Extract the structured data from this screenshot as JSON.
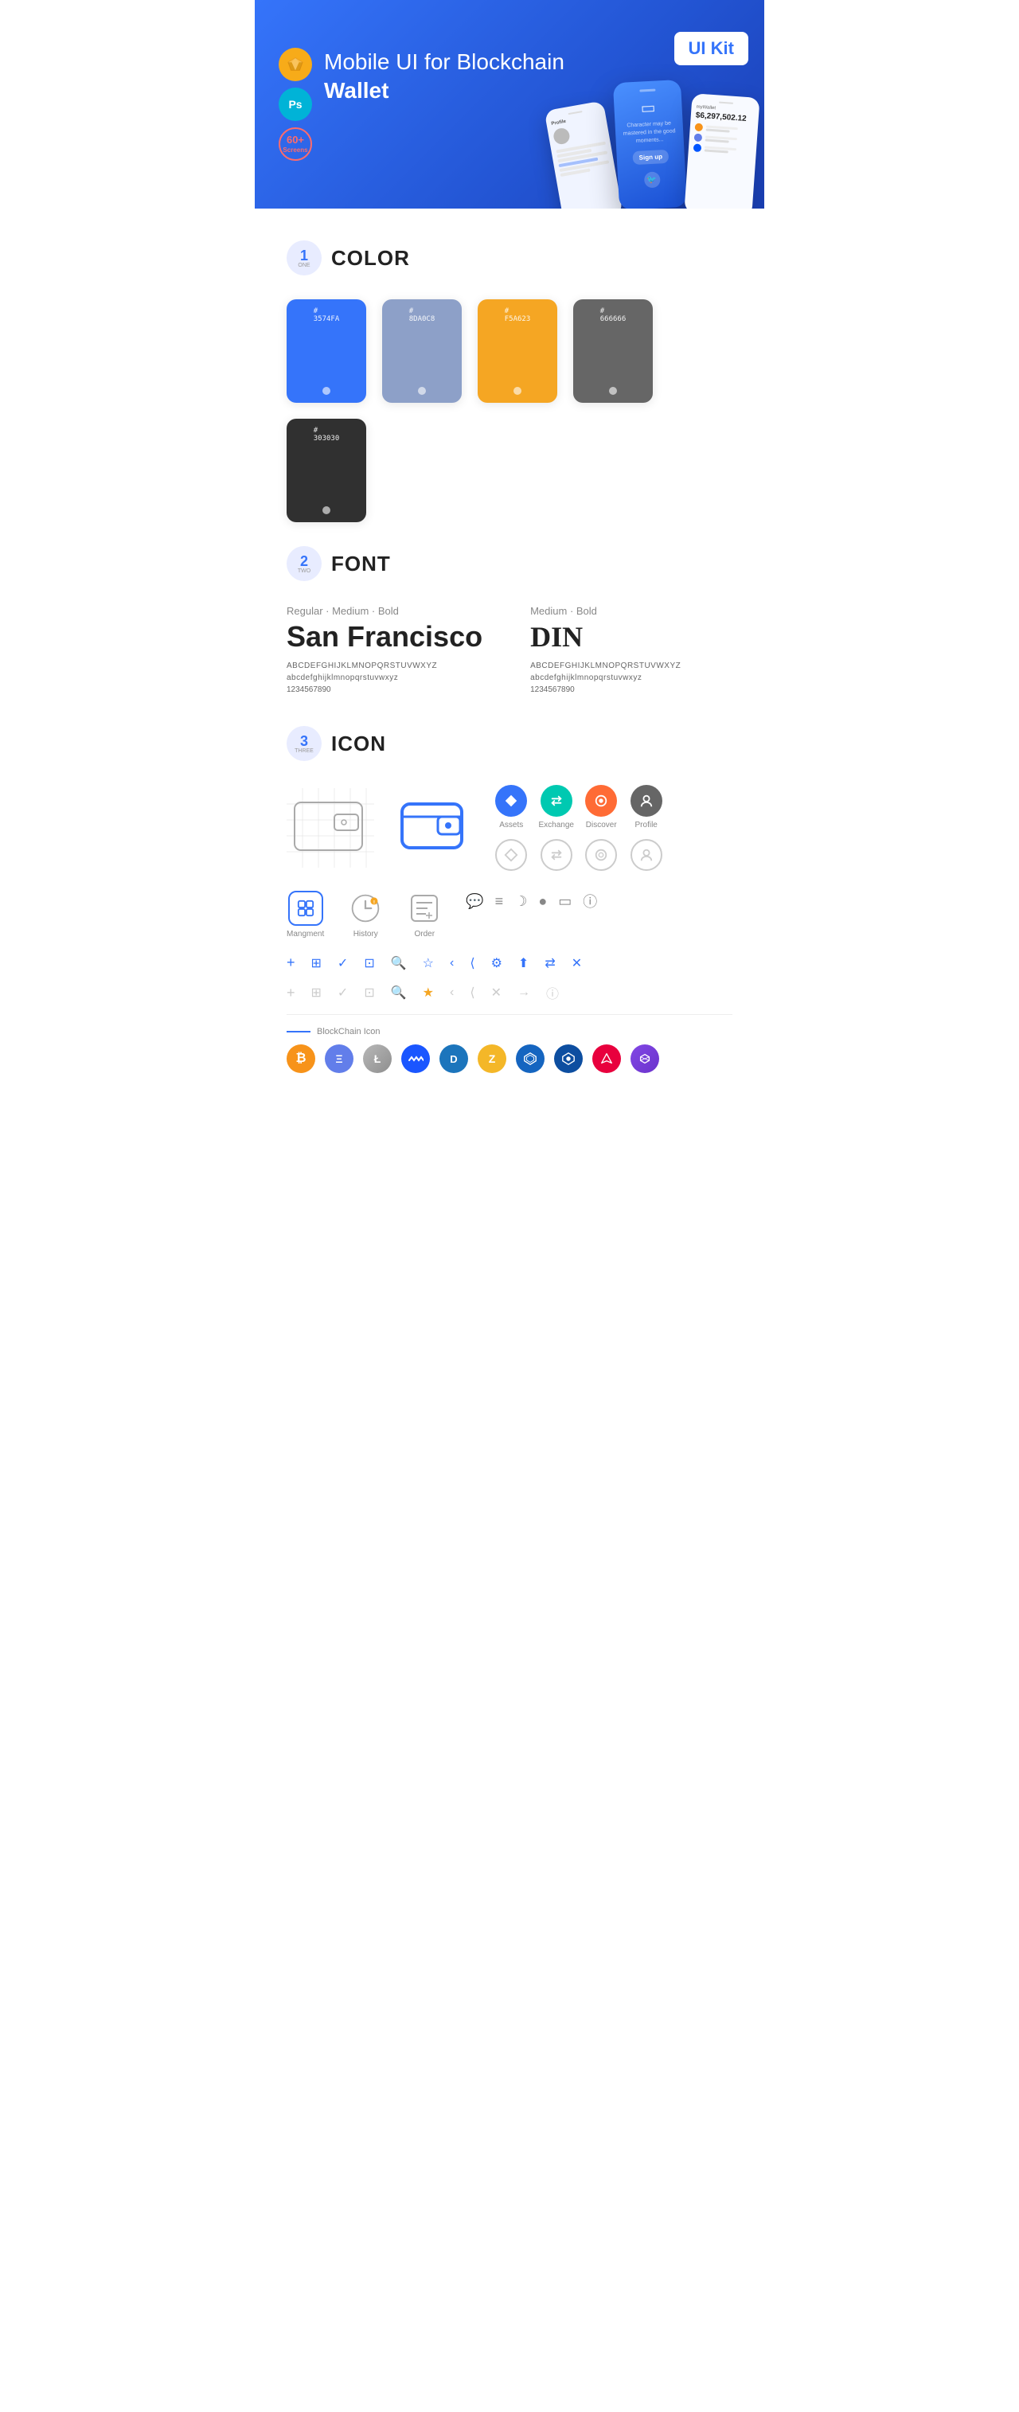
{
  "hero": {
    "title_regular": "Mobile UI for Blockchain ",
    "title_bold": "Wallet",
    "badge": "UI Kit",
    "sketch_label": "Sk",
    "ps_label": "Ps",
    "screens_label": "60+\nScreens"
  },
  "sections": {
    "color": {
      "number": "1",
      "number_sub": "ONE",
      "title": "COLOR",
      "swatches": [
        {
          "hex": "#3574FA",
          "label": "#\n3574FA",
          "bg": "#3574FA"
        },
        {
          "hex": "#8DA0C8",
          "label": "#\n8DA0C8",
          "bg": "#8DA0C8"
        },
        {
          "hex": "#F5A623",
          "label": "#\nF5A623",
          "bg": "#F5A623"
        },
        {
          "hex": "#666666",
          "label": "#\n666666",
          "bg": "#666666"
        },
        {
          "hex": "#303030",
          "label": "#\n303030",
          "bg": "#303030"
        }
      ]
    },
    "font": {
      "number": "2",
      "number_sub": "TWO",
      "title": "FONT",
      "col1": {
        "style": "Regular · Medium · Bold",
        "name": "San Francisco",
        "upper": "ABCDEFGHIJKLMNOPQRSTUVWXYZ",
        "lower": "abcdefghijklmnopqrstuvwxyz",
        "numbers": "1234567890"
      },
      "col2": {
        "style": "Medium · Bold",
        "name": "DIN",
        "upper": "ABCDEFGHIJKLMNOPQRSTUVWXYZ",
        "lower": "abcdefghijklmnopqrstuvwxyz",
        "numbers": "1234567890"
      }
    },
    "icon": {
      "number": "3",
      "number_sub": "THREE",
      "title": "ICON",
      "nav_items": [
        {
          "label": "Assets",
          "type": "blue"
        },
        {
          "label": "Exchange",
          "type": "teal"
        },
        {
          "label": "Discover",
          "type": "orange"
        },
        {
          "label": "Profile",
          "type": "gray"
        }
      ],
      "bottom_nav": [
        {
          "label": "Mangment",
          "icon": "▣"
        },
        {
          "label": "History",
          "icon": "⏱"
        },
        {
          "label": "Order",
          "icon": "📋"
        }
      ],
      "blockchain_label": "BlockChain Icon",
      "cryptos": [
        {
          "name": "BTC",
          "symbol": "₿",
          "class": "crypto-btc"
        },
        {
          "name": "ETH",
          "symbol": "Ξ",
          "class": "crypto-eth"
        },
        {
          "name": "LTC",
          "symbol": "Ł",
          "class": "crypto-ltc"
        },
        {
          "name": "WAVES",
          "symbol": "W",
          "class": "crypto-waves"
        },
        {
          "name": "DASH",
          "symbol": "D",
          "class": "crypto-dash"
        },
        {
          "name": "ZEC",
          "symbol": "Z",
          "class": "crypto-zcash"
        },
        {
          "name": "GRID",
          "symbol": "⬡",
          "class": "crypto-grid"
        },
        {
          "name": "LSK",
          "symbol": "L",
          "class": "crypto-lisk"
        },
        {
          "name": "ARK",
          "symbol": "Λ",
          "class": "crypto-ark"
        },
        {
          "name": "MATIC",
          "symbol": "◆",
          "class": "crypto-matic"
        }
      ]
    }
  }
}
